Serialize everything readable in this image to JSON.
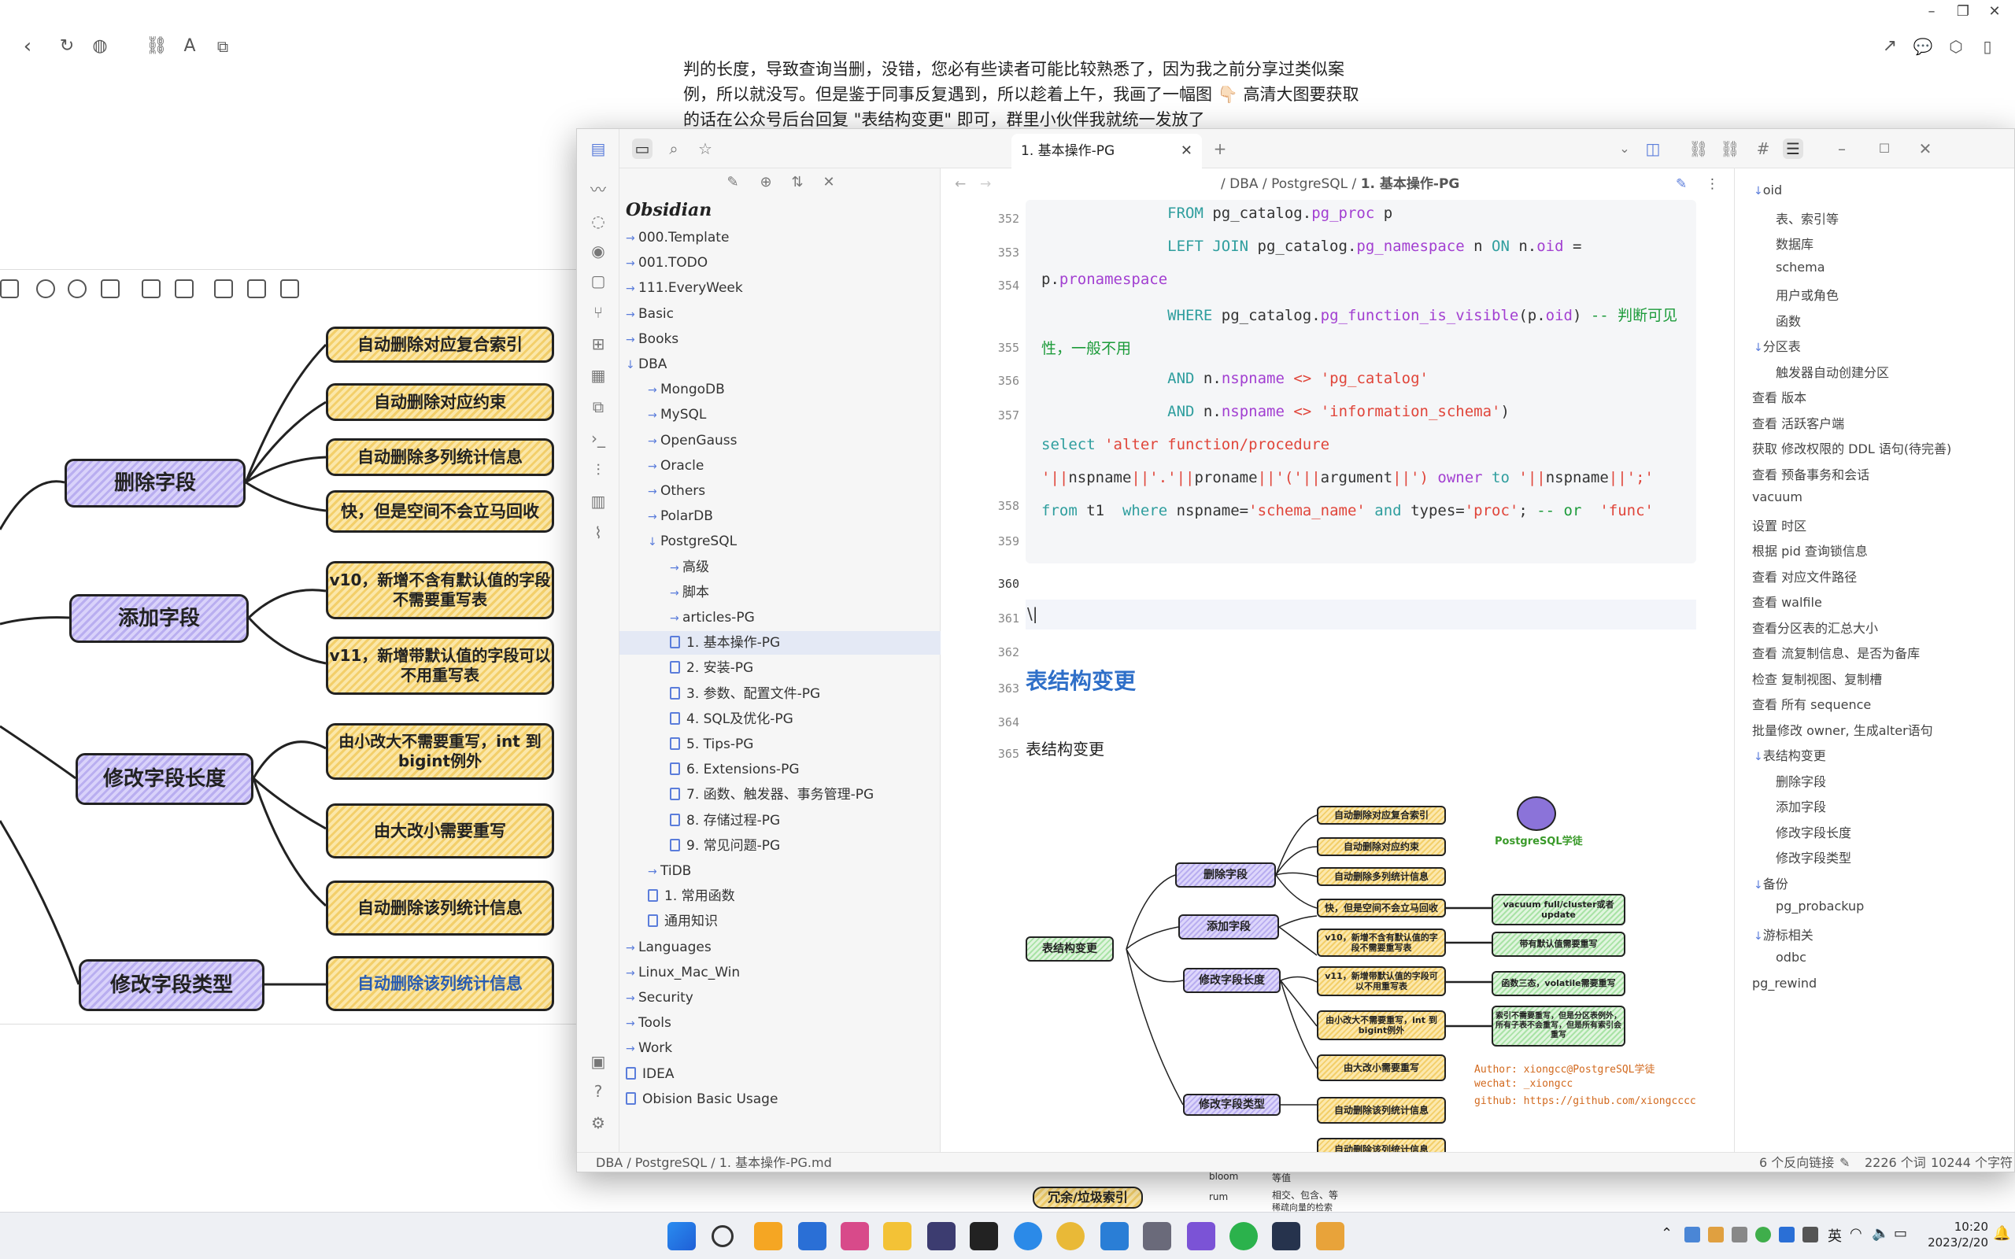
{
  "background": {
    "article_lines": [
      "判的长度，导致查询当删，没错，您必有些读者可能比较熟悉了，因为我之前分享过类似案",
      "例，所以就没写。但是鉴于同事反复遇到，所以趁着上午，我画了一幅图 👇🏻 高清大图要获取",
      "的话在公众号后台回复 \"表结构变更\" 即可，群里小伙伴我就统一发放了"
    ],
    "mindmap": {
      "branches": [
        "删除字段",
        "添加字段",
        "修改字段长度",
        "修改字段类型"
      ],
      "leaves": [
        "自动删除对应复合索引",
        "自动删除对应约束",
        "自动删除多列统计信息",
        "快，但是空间不会立马回收",
        "v10，新增不含有默认值的字段不需要重写表",
        "v11，新增带默认值的字段可以不用重写表",
        "由小改大不需要重写，int 到bigint例外",
        "由大改小需要重写",
        "自动删除该列统计信息",
        "自动删除该列统计信息"
      ]
    },
    "bottom_snippets": [
      "冗余/垃圾索引",
      "bloom",
      "等值",
      "rum",
      "相交、包含、等",
      "稀疏向量的检索"
    ]
  },
  "obsidian": {
    "vault_name": "Obsidian",
    "tab_title": "1. 基本操作-PG",
    "breadcrumb": [
      "DBA",
      "PostgreSQL",
      "1. 基本操作-PG"
    ],
    "tree": [
      {
        "label": "000.Template",
        "level": 0,
        "type": "folder"
      },
      {
        "label": "001.TODO",
        "level": 0,
        "type": "folder"
      },
      {
        "label": "111.EveryWeek",
        "level": 0,
        "type": "folder"
      },
      {
        "label": "Basic",
        "level": 0,
        "type": "folder"
      },
      {
        "label": "Books",
        "level": 0,
        "type": "folder"
      },
      {
        "label": "DBA",
        "level": 0,
        "type": "folder-open"
      },
      {
        "label": "MongoDB",
        "level": 1,
        "type": "folder"
      },
      {
        "label": "MySQL",
        "level": 1,
        "type": "folder"
      },
      {
        "label": "OpenGauss",
        "level": 1,
        "type": "folder"
      },
      {
        "label": "Oracle",
        "level": 1,
        "type": "folder"
      },
      {
        "label": "Others",
        "level": 1,
        "type": "folder"
      },
      {
        "label": "PolarDB",
        "level": 1,
        "type": "folder"
      },
      {
        "label": "PostgreSQL",
        "level": 1,
        "type": "folder-open"
      },
      {
        "label": "高级",
        "level": 2,
        "type": "folder"
      },
      {
        "label": "脚本",
        "level": 2,
        "type": "folder"
      },
      {
        "label": "articles-PG",
        "level": 2,
        "type": "folder"
      },
      {
        "label": "1. 基本操作-PG",
        "level": 2,
        "type": "file",
        "selected": true
      },
      {
        "label": "2. 安装-PG",
        "level": 2,
        "type": "file"
      },
      {
        "label": "3. 参数、配置文件-PG",
        "level": 2,
        "type": "file"
      },
      {
        "label": "4. SQL及优化-PG",
        "level": 2,
        "type": "file"
      },
      {
        "label": "5. Tips-PG",
        "level": 2,
        "type": "file"
      },
      {
        "label": "6. Extensions-PG",
        "level": 2,
        "type": "file"
      },
      {
        "label": "7. 函数、触发器、事务管理-PG",
        "level": 2,
        "type": "file"
      },
      {
        "label": "8. 存储过程-PG",
        "level": 2,
        "type": "file"
      },
      {
        "label": "9. 常见问题-PG",
        "level": 2,
        "type": "file"
      },
      {
        "label": "TiDB",
        "level": 1,
        "type": "folder"
      },
      {
        "label": "1. 常用函数",
        "level": 1,
        "type": "file"
      },
      {
        "label": "通用知识",
        "level": 1,
        "type": "file"
      },
      {
        "label": "Languages",
        "level": 0,
        "type": "folder"
      },
      {
        "label": "Linux_Mac_Win",
        "level": 0,
        "type": "folder"
      },
      {
        "label": "Security",
        "level": 0,
        "type": "folder"
      },
      {
        "label": "Tools",
        "level": 0,
        "type": "folder"
      },
      {
        "label": "Work",
        "level": 0,
        "type": "folder"
      },
      {
        "label": "IDEA",
        "level": 0,
        "type": "file"
      },
      {
        "label": "Obision Basic Usage",
        "level": 0,
        "type": "file"
      }
    ],
    "line_numbers": [
      "352",
      "353",
      "354",
      "355",
      "356",
      "357",
      "358",
      "359",
      "360",
      "361",
      "362",
      "363",
      "364",
      "365"
    ],
    "heading": "表结构变更",
    "paragraph": "表结构变更",
    "cursor_line": "\\|",
    "embedded_mindmap": {
      "root": "表结构变更",
      "branches": [
        "删除字段",
        "添加字段",
        "修改字段长度",
        "修改字段类型"
      ],
      "leaves": [
        "自动删除对应复合索引",
        "自动删除对应约束",
        "自动删除多列统计信息",
        "快，但是空间不会立马回收",
        "v10，新增不含有默认值的字段不需要重写表",
        "v11，新增带默认值的字段可以不用重写表",
        "由小改大不需要重写，int 到bigint例外",
        "由大改小需要重写",
        "自动删除该列统计信息",
        "自动删除该列统计信息"
      ],
      "notes": [
        "vacuum full/cluster或者update",
        "带有默认值需要重写",
        "函数三态，volatile需要重写",
        "索引不需要重写，但是分区表例外，所有子表不会重写，但是所有索引会重写"
      ],
      "logo_text": "PostgreSQL学徒",
      "credits": [
        "Author: xiongcc@PostgreSQL学徒",
        "wechat: _xiongcc",
        "github: https://github.com/xiongcccc"
      ]
    },
    "outline": [
      {
        "label": "oid",
        "level": 0,
        "arrow": true
      },
      {
        "label": "表、索引等",
        "level": 1
      },
      {
        "label": "数据库",
        "level": 1
      },
      {
        "label": "schema",
        "level": 1
      },
      {
        "label": "用户或角色",
        "level": 1
      },
      {
        "label": "函数",
        "level": 1
      },
      {
        "label": "分区表",
        "level": 0,
        "arrow": true
      },
      {
        "label": "触发器自动创建分区",
        "level": 1
      },
      {
        "label": "查看 版本",
        "level": 0
      },
      {
        "label": "查看 活跃客户端",
        "level": 0
      },
      {
        "label": "获取 修改权限的 DDL 语句(待完善)",
        "level": 0
      },
      {
        "label": "查看 预备事务和会话",
        "level": 0
      },
      {
        "label": "vacuum",
        "level": 0
      },
      {
        "label": "设置 时区",
        "level": 0
      },
      {
        "label": "根据 pid 查询锁信息",
        "level": 0
      },
      {
        "label": "查看 对应文件路径",
        "level": 0
      },
      {
        "label": "查看 walfile",
        "level": 0
      },
      {
        "label": "查看分区表的汇总大小",
        "level": 0
      },
      {
        "label": "查看 流复制信息、是否为备库",
        "level": 0
      },
      {
        "label": "检查 复制视图、复制槽",
        "level": 0
      },
      {
        "label": "查看 所有 sequence",
        "level": 0
      },
      {
        "label": "批量修改 owner, 生成alter语句",
        "level": 0
      },
      {
        "label": "表结构变更",
        "level": 0,
        "arrow": true
      },
      {
        "label": "删除字段",
        "level": 1
      },
      {
        "label": "添加字段",
        "level": 1
      },
      {
        "label": "修改字段长度",
        "level": 1
      },
      {
        "label": "修改字段类型",
        "level": 1
      },
      {
        "label": "备份",
        "level": 0,
        "arrow": true
      },
      {
        "label": "pg_probackup",
        "level": 1
      },
      {
        "label": "游标相关",
        "level": 0,
        "arrow": true
      },
      {
        "label": "odbc",
        "level": 1
      },
      {
        "label": "pg_rewind",
        "level": 0
      }
    ],
    "status": {
      "path": "DBA / PostgreSQL / 1. 基本操作-PG.md",
      "backlinks": "6 个反向链接",
      "words": "2226 个词",
      "chars": "10244 个字符"
    }
  },
  "taskbar": {
    "ime": "英",
    "time": "10:20",
    "date": "2023/2/20"
  },
  "colors": {
    "accent": "#5b7ddb",
    "heading": "#2f6fc8",
    "purple_node": "#b9aef0",
    "yellow_node": "#f3cf6a",
    "green_node": "#a9e3a6"
  }
}
